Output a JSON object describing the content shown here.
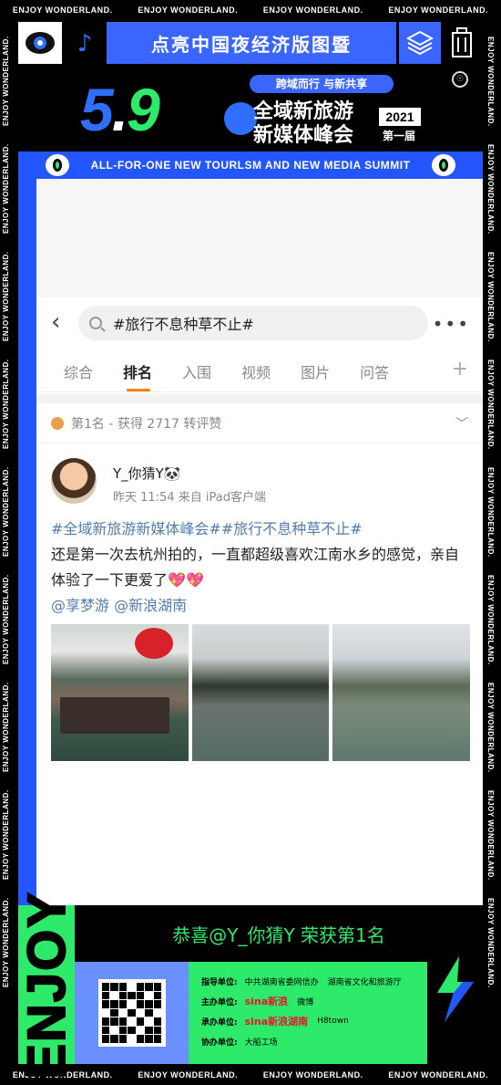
{
  "ticker_text": "ENJOY WONDERLAND.",
  "side_text": "ENJOY WONDERLAND.",
  "header": {
    "banner_text": "点亮中国夜经济版图暨"
  },
  "hero": {
    "numbers": [
      "5",
      ".",
      "9"
    ],
    "tagline": "跨域而行  与新共享",
    "title_line1": "全域新旅游",
    "title_line2": "新媒体峰会",
    "year": "2021",
    "edition": "第一届"
  },
  "summit_en": "ALL-FOR-ONE NEW TOURLSM AND NEW MEDIA SUMMIT",
  "search": {
    "query": "#旅行不息种草不止#"
  },
  "tabs": [
    "综合",
    "排名",
    "入围",
    "视频",
    "图片",
    "问答"
  ],
  "active_tab": "排名",
  "rank_text": "第1名 - 获得 2717 转评赞",
  "post": {
    "username": "Y_你猜Y🐼",
    "time": "昨天 11:54",
    "source": "来自 iPad客户端",
    "hashtags": "#全域新旅游新媒体峰会##旅行不息种草不止#",
    "body": "还是第一次去杭州拍的，一直都超级喜欢江南水乡的感觉，亲自体验了一下更爱了",
    "emoji": "💖💖",
    "mentions": "@享梦游 @新浪湖南"
  },
  "footer": {
    "enjoy": "ENJOY",
    "congrats": "恭喜@Y_你猜Y 荣获第1名",
    "orgs": [
      {
        "key": "指导单位:",
        "values": [
          "中共湖南省委网信办",
          "湖南省文化和旅游厅"
        ]
      },
      {
        "key": "主办单位:",
        "values": [
          "sina新浪",
          "微博"
        ]
      },
      {
        "key": "承办单位:",
        "values": [
          "sina新浪湖南",
          "H8town"
        ]
      },
      {
        "key": "协办单位:",
        "values": [
          "大船工场"
        ]
      }
    ]
  },
  "colors": {
    "accent_blue": "#2356ff",
    "accent_green": "#2eea6a",
    "tab_underline": "#ff8200",
    "link": "#507daf"
  }
}
